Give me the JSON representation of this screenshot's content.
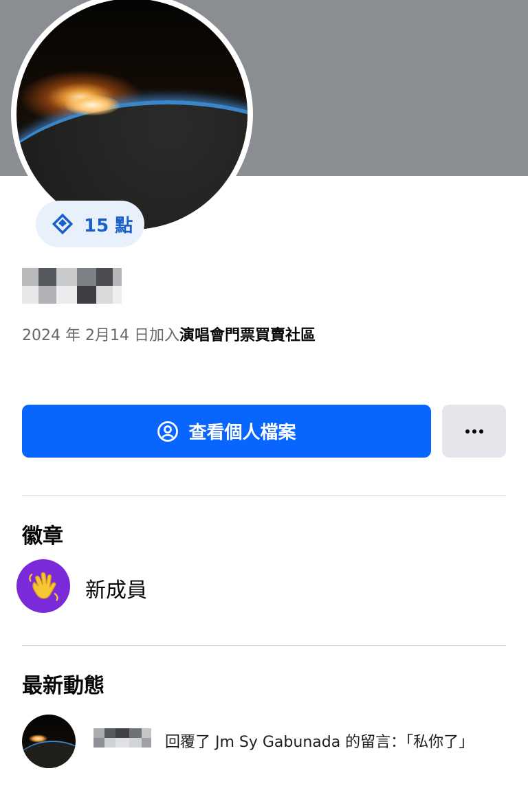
{
  "profile": {
    "points_label": "15 點",
    "joined_prefix": "2024 年 2月14 日加入",
    "group_name": "演唱會門票買賣社區"
  },
  "actions": {
    "view_profile_label": "查看個人檔案",
    "more_label": "•••"
  },
  "badges": {
    "title": "徽章",
    "items": [
      {
        "label": "新成員",
        "icon": "waving-hand-icon"
      }
    ]
  },
  "activity": {
    "title": "最新動態",
    "items": [
      {
        "text": "回覆了 Jm Sy Gabunada 的留言：「私你了」"
      }
    ]
  },
  "colors": {
    "cover": "#8a8d91",
    "primary_button": "#0866ff",
    "secondary_button": "#e4e6eb",
    "badge_bg": "#7b2ad9",
    "points_text": "#1a5fc7"
  }
}
